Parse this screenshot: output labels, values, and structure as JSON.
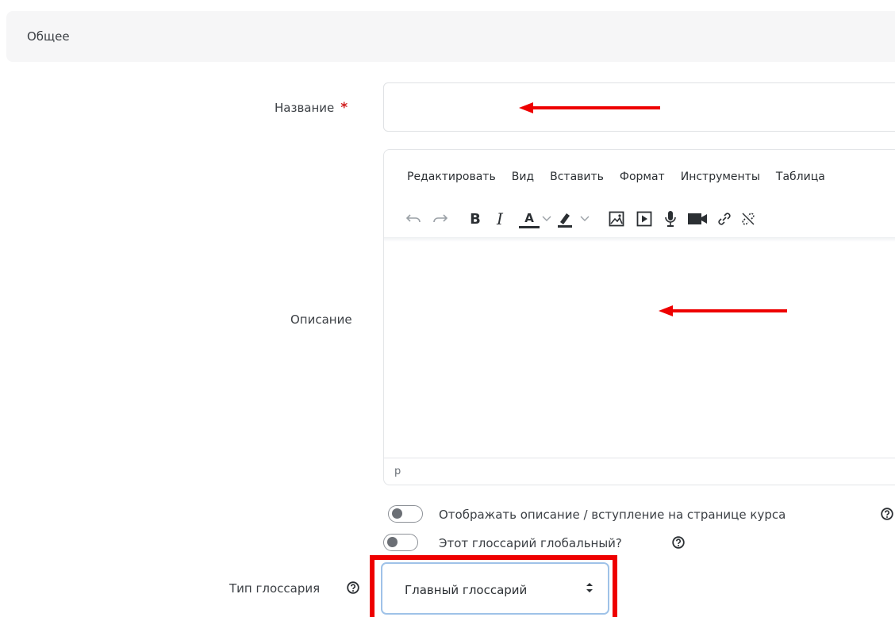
{
  "section": {
    "title": "Общее"
  },
  "name_field": {
    "label": "Название",
    "required_mark": "*",
    "value": ""
  },
  "description": {
    "label": "Описание",
    "menu": [
      "Редактировать",
      "Вид",
      "Вставить",
      "Формат",
      "Инструменты",
      "Таблица"
    ],
    "toolbar": {
      "undo": "undo-icon",
      "redo": "redo-icon",
      "bold": "B",
      "italic": "I",
      "text_color": "A",
      "highlight": "highlight-icon",
      "image": "image-icon",
      "media": "media-icon",
      "record_audio": "microphone-icon",
      "record_video": "video-camera-icon",
      "link": "link-icon",
      "unlink": "unlink-icon"
    },
    "status_path": "p"
  },
  "toggles": [
    {
      "label": "Отображать описание / вступление на странице курса",
      "on": false
    },
    {
      "label": "Этот глоссарий глобальный?",
      "on": false
    }
  ],
  "glossary_type": {
    "label": "Тип глоссария",
    "value": "Главный глоссарий"
  },
  "annotation_color": "#ee0000"
}
